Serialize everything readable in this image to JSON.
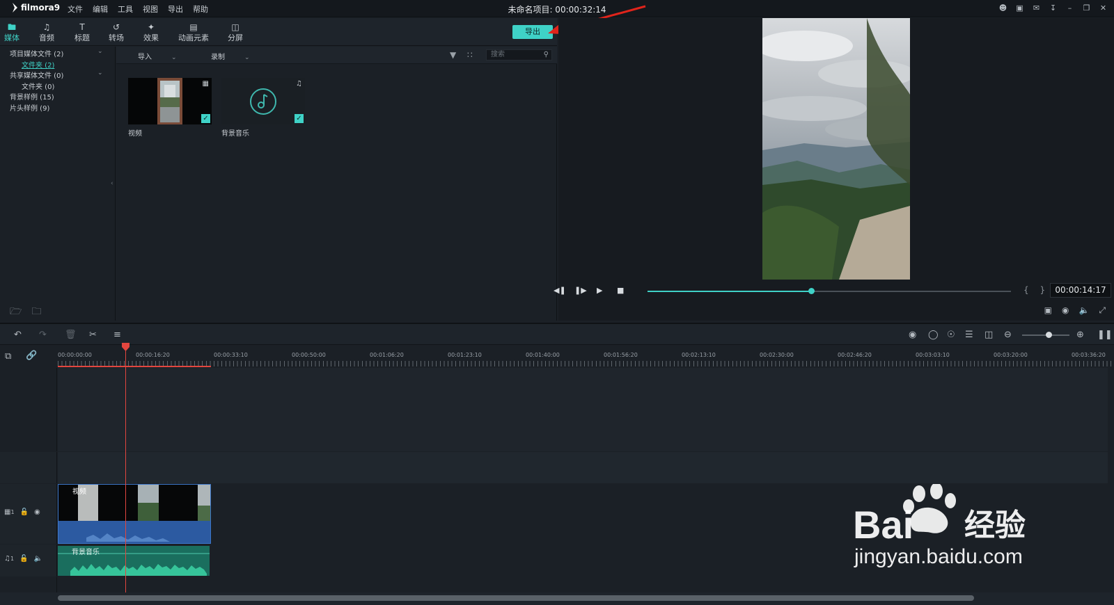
{
  "app": {
    "logo_text": "filmora9",
    "menu": [
      "文件",
      "编辑",
      "工具",
      "视图",
      "导出",
      "帮助"
    ],
    "project_title": "未命名项目: 00:00:32:14"
  },
  "media_tabs": [
    {
      "label": "媒体",
      "icon": "folder-icon",
      "active": true
    },
    {
      "label": "音频",
      "icon": "music-note-icon"
    },
    {
      "label": "标题",
      "icon": "title-text-icon"
    },
    {
      "label": "转场",
      "icon": "transition-icon"
    },
    {
      "label": "效果",
      "icon": "effects-icon"
    },
    {
      "label": "动画元素",
      "icon": "elements-icon"
    },
    {
      "label": "分屏",
      "icon": "split-screen-icon"
    }
  ],
  "export_label": "导出",
  "tree": [
    {
      "label": "项目媒体文件 (2)",
      "expandable": true
    },
    {
      "label": "文件夹 (2)",
      "selected": true,
      "sub": true
    },
    {
      "label": "共享媒体文件 (0)",
      "expandable": true
    },
    {
      "label": "文件夹 (0)",
      "sub": true
    },
    {
      "label": "背景样例 (15)"
    },
    {
      "label": "片头样例 (9)"
    }
  ],
  "library": {
    "import_label": "导入",
    "record_label": "录制",
    "search_placeholder": "搜索",
    "clips": [
      {
        "name": "视频",
        "type": "video",
        "checked": true
      },
      {
        "name": "背景音乐",
        "type": "audio",
        "checked": true
      }
    ]
  },
  "preview": {
    "timecode": "00:00:14:17",
    "progress": 0.45
  },
  "ruler": {
    "labels": [
      "00:00:00:00",
      "00:00:16:20",
      "00:00:33:10",
      "00:00:50:00",
      "00:01:06:20",
      "00:01:23:10",
      "00:01:40:00",
      "00:01:56:20",
      "00:02:13:10",
      "00:02:30:00",
      "00:02:46:20",
      "00:03:03:10",
      "00:03:20:00",
      "00:03:36:20"
    ]
  },
  "tracks": {
    "video_track_num": "1",
    "audio_track_num": "1",
    "video_clip_label": "视频",
    "audio_clip_label": "背景音乐"
  },
  "watermark": {
    "line1": "Bai",
    "line1b": "经验",
    "line2": "jingyan.baidu.com"
  },
  "colors": {
    "accent": "#3fd2c7",
    "playhead": "#e3463f",
    "bg": "#1b2026"
  }
}
